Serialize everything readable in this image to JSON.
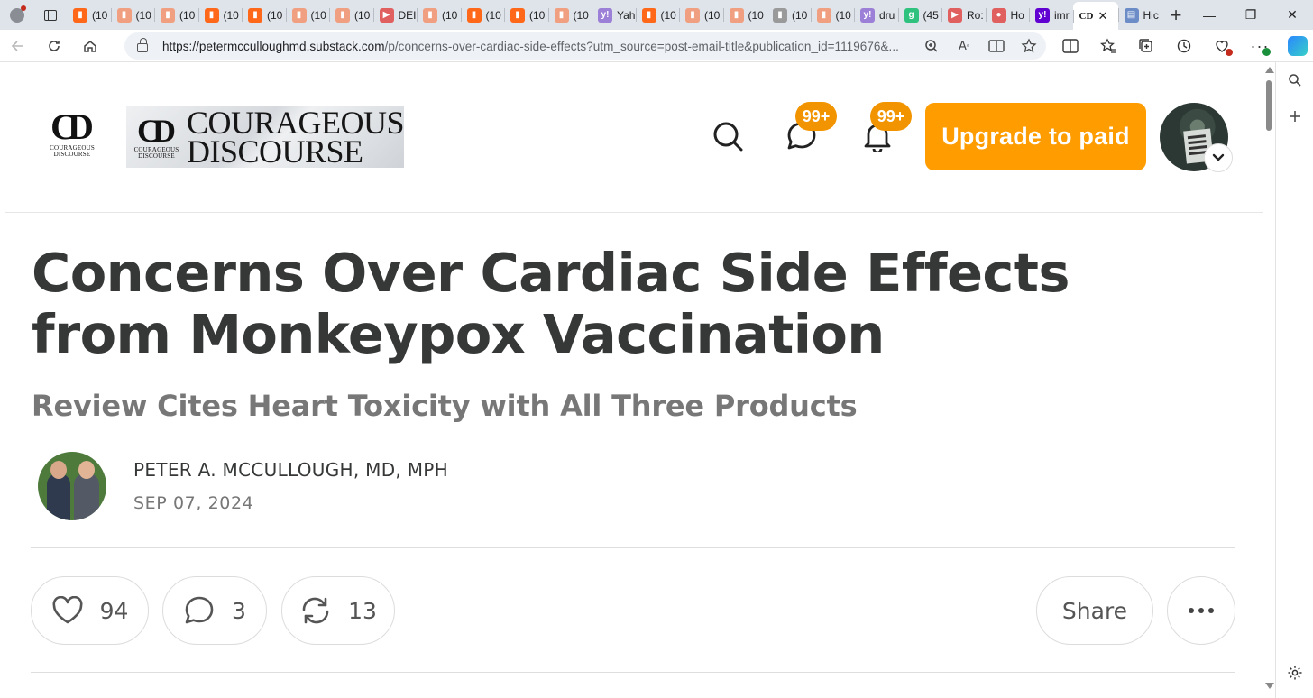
{
  "browser": {
    "tabs": [
      {
        "title": "(10",
        "favicon": "substack",
        "color": "#ff6719",
        "letter": "▮"
      },
      {
        "title": "(10",
        "favicon": "substack",
        "color": "#f0a080",
        "letter": "▮"
      },
      {
        "title": "(10",
        "favicon": "substack",
        "color": "#f0a080",
        "letter": "▮"
      },
      {
        "title": "(10",
        "favicon": "substack",
        "color": "#ff6719",
        "letter": "▮"
      },
      {
        "title": "(10",
        "favicon": "substack",
        "color": "#ff6719",
        "letter": "▮"
      },
      {
        "title": "(10",
        "favicon": "substack",
        "color": "#f0a080",
        "letter": "▮"
      },
      {
        "title": "(10",
        "favicon": "substack",
        "color": "#f0a080",
        "letter": "▮"
      },
      {
        "title": "DEI",
        "favicon": "youtube",
        "color": "#e06060",
        "letter": "▶"
      },
      {
        "title": "(10",
        "favicon": "substack",
        "color": "#f0a080",
        "letter": "▮"
      },
      {
        "title": "(10",
        "favicon": "substack",
        "color": "#ff6719",
        "letter": "▮"
      },
      {
        "title": "(10",
        "favicon": "substack",
        "color": "#ff6719",
        "letter": "▮"
      },
      {
        "title": "(10",
        "favicon": "substack",
        "color": "#f0a080",
        "letter": "▮"
      },
      {
        "title": "Yah",
        "favicon": "yahoo",
        "color": "#9c7fd6",
        "letter": "y!"
      },
      {
        "title": "(10",
        "favicon": "substack",
        "color": "#ff6719",
        "letter": "▮"
      },
      {
        "title": "(10",
        "favicon": "substack",
        "color": "#f0a080",
        "letter": "▮"
      },
      {
        "title": "(10",
        "favicon": "substack",
        "color": "#f0a080",
        "letter": "▮"
      },
      {
        "title": "(10",
        "favicon": "photo",
        "color": "#9a9a9a",
        "letter": "▮"
      },
      {
        "title": "(10",
        "favicon": "substack",
        "color": "#f0a080",
        "letter": "▮"
      },
      {
        "title": "dru",
        "favicon": "yahoo",
        "color": "#9c7fd6",
        "letter": "y!"
      },
      {
        "title": "(45",
        "favicon": "grammarly",
        "color": "#2ec27e",
        "letter": "g"
      },
      {
        "title": "Ro:",
        "favicon": "youtube",
        "color": "#e06060",
        "letter": "▶"
      },
      {
        "title": "Ho",
        "favicon": "podcast",
        "color": "#e06060",
        "letter": "●"
      },
      {
        "title": "imr",
        "favicon": "yahoo",
        "color": "#6001d2",
        "letter": "y!"
      },
      {
        "title": "",
        "favicon": "courageous-discourse",
        "color": "#ffffff",
        "letter": "CD",
        "active": true
      },
      {
        "title": "Hic",
        "favicon": "doc",
        "color": "#6b8cc7",
        "letter": "▤"
      }
    ],
    "url_host": "https://petermcculloughmd.substack.com",
    "url_path": "/p/concerns-over-cardiac-side-effects?utm_source=post-email-title&publication_id=1119676&..."
  },
  "header": {
    "logo_small_sub": "COURAGEOUS DISCOURSE",
    "logo_word_line1": "COURAGEOUS",
    "logo_word_line2": "DISCOURSE",
    "logo_mark_sub": "COURAGEOUS DISCOURSE",
    "chat_badge": "99+",
    "notif_badge": "99+",
    "upgrade_label": "Upgrade to paid",
    "accent_color": "#ff9d00"
  },
  "post": {
    "title": "Concerns Over Cardiac Side Effects from Monkeypox Vaccination",
    "subtitle": "Review Cites Heart Toxicity with All Three Products",
    "author": "PETER A. MCCULLOUGH, MD, MPH",
    "date": "SEP 07, 2024"
  },
  "actions": {
    "likes": "94",
    "comments": "3",
    "restacks": "13",
    "share_label": "Share"
  }
}
